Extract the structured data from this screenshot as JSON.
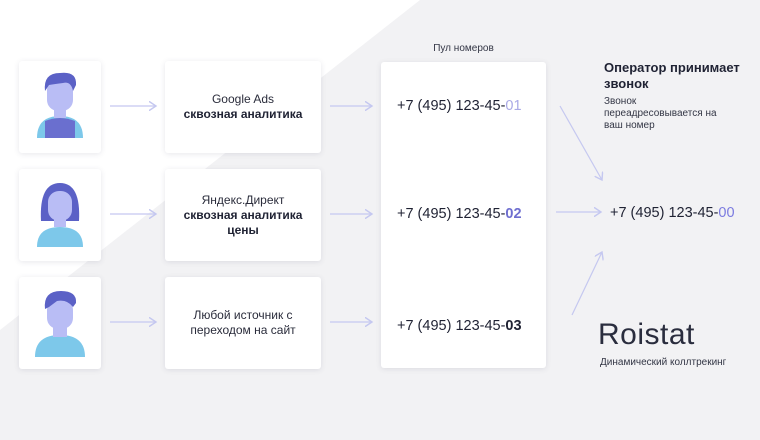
{
  "pool": {
    "label": "Пул номеров"
  },
  "rows": [
    {
      "source_line1": "Google Ads",
      "source_line2": "сквозная аналитика",
      "phone_prefix": "+7 (495) 123-45-",
      "phone_suffix": "01"
    },
    {
      "source_line1": "Яндекс.Директ",
      "source_line2": "сквозная аналитика цены",
      "phone_prefix": "+7 (495) 123-45-",
      "phone_suffix": "02"
    },
    {
      "source_line1": "Любой источник с переходом на сайт",
      "source_line2": "",
      "phone_prefix": "+7 (495) 123-45-",
      "phone_suffix": "03"
    }
  ],
  "operator": {
    "title": "Оператор принимает звонок",
    "subtitle": "Звонок переадресовывается на ваш номер",
    "phone_prefix": "+7 (495) 123-45-",
    "phone_suffix": "00"
  },
  "brand": {
    "logo": "Roistat",
    "tagline": "Динамический коллтрекинг"
  },
  "colors": {
    "accent": "#6f6fd0",
    "accent_light": "#a9a9e6",
    "background_shape": "#f2f2f4",
    "face": "#b9bdf5",
    "hair": "#5b61c6",
    "shirt_purple": "#6a6fcf",
    "shirt_blue": "#7dc8ea"
  }
}
